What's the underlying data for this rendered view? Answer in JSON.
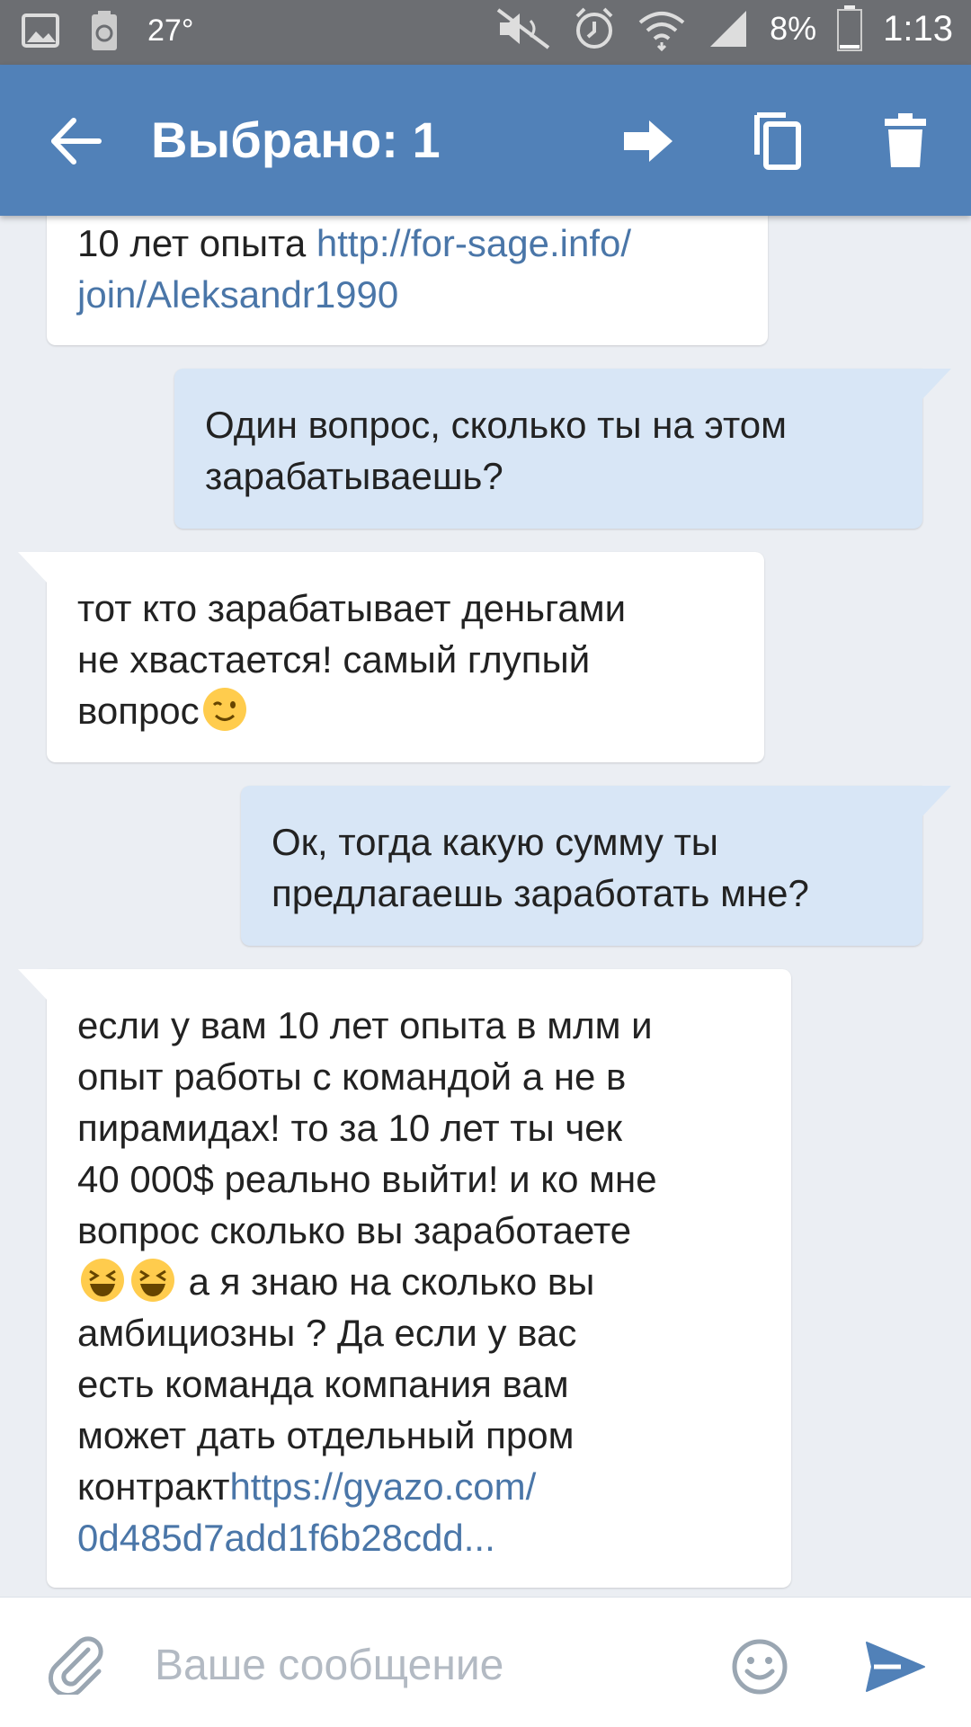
{
  "status_bar": {
    "temperature": "27°",
    "battery": "8%",
    "time": "1:13",
    "icons": [
      "gallery-icon",
      "recycle-icon",
      "mute-icon",
      "alarm-icon",
      "wifi-icon",
      "signal-icon",
      "battery-icon"
    ]
  },
  "app_bar": {
    "title": "Выбрано: 1",
    "back_icon": "arrow-back-icon",
    "actions": [
      "forward-icon",
      "copy-icon",
      "delete-icon"
    ],
    "background_color": "#5181b8"
  },
  "messages": [
    {
      "direction": "incoming",
      "lines": [
        "10 лет опыта "
      ],
      "link": "http://for-sage.info/join/Aleksandr1990",
      "link_lines": [
        "http://for-sage.info/",
        "join/Aleksandr1990"
      ]
    },
    {
      "direction": "outgoing",
      "lines": [
        "Один вопрос, сколько ты на этом",
        "зарабатываешь?"
      ]
    },
    {
      "direction": "incoming",
      "lines": [
        "тот кто зарабатывает деньгами",
        "не хвастается! самый глупый",
        "вопрос"
      ],
      "emoji": [
        "wink-emoji"
      ]
    },
    {
      "direction": "outgoing",
      "lines": [
        "Ок, тогда какую сумму ты",
        "предлагаешь заработать мне?"
      ]
    },
    {
      "direction": "incoming",
      "lines": [
        "если у вам 10 лет опыта в млм и",
        "опыт работы с командой а не в",
        "пирамидах! то за 10 лет ты чек",
        "40 000$ реально выйти! и ко мне",
        "вопрос сколько вы заработаете",
        " а я знаю на сколько вы",
        "амбициозны ? Да если у вас",
        "есть команда компания вам",
        "может дать отдельный пром",
        "контракт"
      ],
      "emoji": [
        "laughing-emoji",
        "laughing-emoji"
      ],
      "link_lines": [
        "https://gyazo.com/",
        "0d485d7add1f6b28cdd..."
      ]
    }
  ],
  "composer": {
    "placeholder": "Ваше сообщение",
    "attach_icon": "paperclip-icon",
    "emoji_icon": "smiley-icon",
    "send_icon": "send-icon"
  },
  "colors": {
    "outgoing_bubble": "#d8e6f6",
    "incoming_bubble": "#ffffff",
    "link": "#4a76a8",
    "background": "#ebeef3"
  }
}
